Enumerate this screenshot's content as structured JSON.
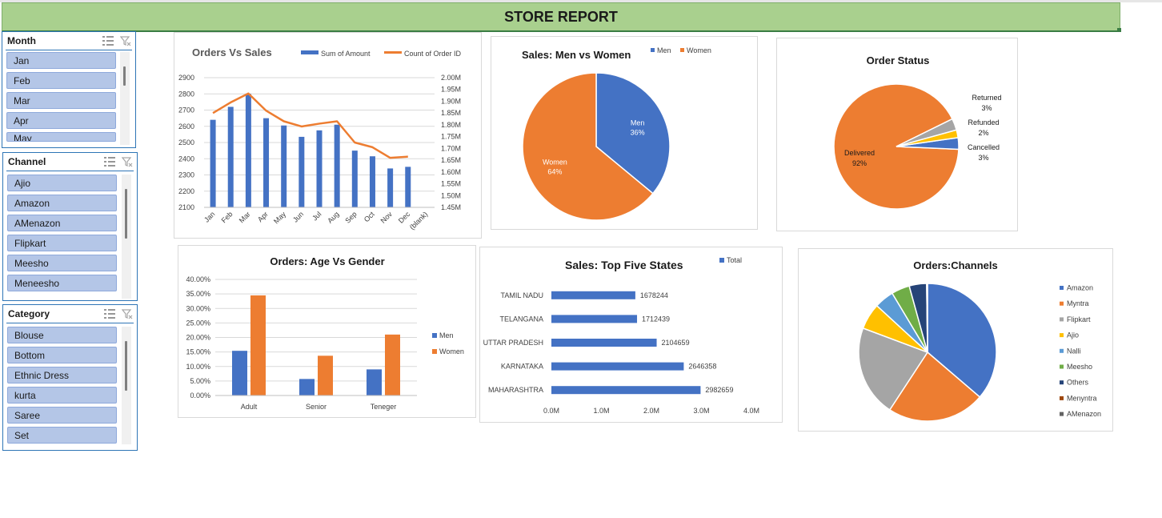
{
  "title": "STORE REPORT",
  "slicers": {
    "month": {
      "title": "Month",
      "items": [
        "Jan",
        "Feb",
        "Mar",
        "Apr",
        "May"
      ]
    },
    "channel": {
      "title": "Channel",
      "items": [
        "Ajio",
        "Amazon",
        "AMenazon",
        "Flipkart",
        "Meesho",
        "Meneesho"
      ]
    },
    "category": {
      "title": "Category",
      "items": [
        "Blouse",
        "Bottom",
        "Ethnic Dress",
        "kurta",
        "Saree",
        "Set"
      ]
    }
  },
  "icons": {
    "multiselect": "multi-select-icon",
    "clearfilter": "clear-filter-icon"
  },
  "colors": {
    "blue": "#4472c4",
    "orange": "#ed7d31",
    "gray": "#a5a5a5",
    "yellow": "#ffc000",
    "lightblue": "#5b9bd5",
    "green": "#70ad47",
    "navy": "#264478",
    "darkorange": "#9e480e",
    "slate": "#636363",
    "banner": "#a9d08e"
  },
  "chart_data": [
    {
      "id": "orders_vs_sales",
      "type": "bar",
      "title": "Orders Vs Sales",
      "categories": [
        "Jan",
        "Feb",
        "Mar",
        "Apr",
        "May",
        "Jun",
        "Jul",
        "Aug",
        "Sep",
        "Oct",
        "Nov",
        "Dec",
        "(blank)"
      ],
      "series": [
        {
          "name": "Sum of Amount",
          "axis": "right",
          "kind": "bar",
          "values": [
            1.85,
            1.895,
            1.933,
            1.86,
            1.815,
            1.793,
            1.805,
            1.815,
            1.725,
            1.705,
            1.66,
            1.665,
            null
          ]
        },
        {
          "name": "Count of Order ID",
          "axis": "left",
          "kind": "line",
          "values": [
            2640,
            2720,
            2800,
            2650,
            2605,
            2535,
            2575,
            2610,
            2450,
            2415,
            2340,
            2350,
            null
          ]
        }
      ],
      "left_ticks": [
        "2100",
        "2200",
        "2300",
        "2400",
        "2500",
        "2600",
        "2700",
        "2800",
        "2900"
      ],
      "left_range": [
        2100,
        2900
      ],
      "right_ticks": [
        "1.45M",
        "1.50M",
        "1.55M",
        "1.60M",
        "1.65M",
        "1.70M",
        "1.75M",
        "1.80M",
        "1.85M",
        "1.90M",
        "1.95M",
        "2.00M"
      ],
      "right_range": [
        1.45,
        2.0
      ]
    },
    {
      "id": "sales_men_vs_women",
      "type": "pie",
      "title": "Sales: Men vs Women",
      "slices": [
        {
          "label": "Men",
          "value": 36,
          "text": "36%"
        },
        {
          "label": "Women",
          "value": 64,
          "text": "64%"
        }
      ],
      "legend": [
        "Men",
        "Women"
      ]
    },
    {
      "id": "order_status",
      "type": "pie",
      "title": "Order Status",
      "slices": [
        {
          "label": "Delivered",
          "value": 92,
          "text": "92%"
        },
        {
          "label": "Cancelled",
          "value": 3,
          "text": "3%"
        },
        {
          "label": "Refunded",
          "value": 2,
          "text": "2%"
        },
        {
          "label": "Returned",
          "value": 3,
          "text": "3%"
        }
      ]
    },
    {
      "id": "orders_age_vs_gender",
      "type": "bar",
      "title": "Orders: Age Vs Gender",
      "categories": [
        "Adult",
        "Senior",
        "Teneger"
      ],
      "series": [
        {
          "name": "Men",
          "values": [
            15.4,
            5.7,
            9.0
          ]
        },
        {
          "name": "Women",
          "values": [
            34.5,
            13.7,
            21.0
          ]
        }
      ],
      "yticks": [
        "0.00%",
        "5.00%",
        "10.00%",
        "15.00%",
        "20.00%",
        "25.00%",
        "30.00%",
        "35.00%",
        "40.00%"
      ],
      "ylim": [
        0,
        40
      ]
    },
    {
      "id": "sales_top_five_states",
      "type": "bar",
      "title": "Sales: Top Five States",
      "legend": [
        "Total"
      ],
      "categories": [
        "TAMIL NADU",
        "TELANGANA",
        "UTTAR PRADESH",
        "KARNATAKA",
        "MAHARASHTRA"
      ],
      "values": [
        1678244,
        1712439,
        2104659,
        2646358,
        2982659
      ],
      "labels": [
        "1678244",
        "1712439",
        "2104659",
        "2646358",
        "2982659"
      ],
      "xticks": [
        "0.0M",
        "1.0M",
        "2.0M",
        "3.0M",
        "4.0M"
      ],
      "xlim": [
        0,
        4000000
      ]
    },
    {
      "id": "orders_channels",
      "type": "pie",
      "title": "Orders:Channels",
      "legend": [
        "Amazon",
        "Myntra",
        "Flipkart",
        "Ajio",
        "Nalli",
        "Meesho",
        "Others",
        "Menyntra",
        "AMenazon"
      ],
      "values": [
        35.5,
        22.5,
        21.0,
        6.0,
        4.5,
        4.2,
        4.0,
        0.1,
        0.1
      ]
    }
  ]
}
